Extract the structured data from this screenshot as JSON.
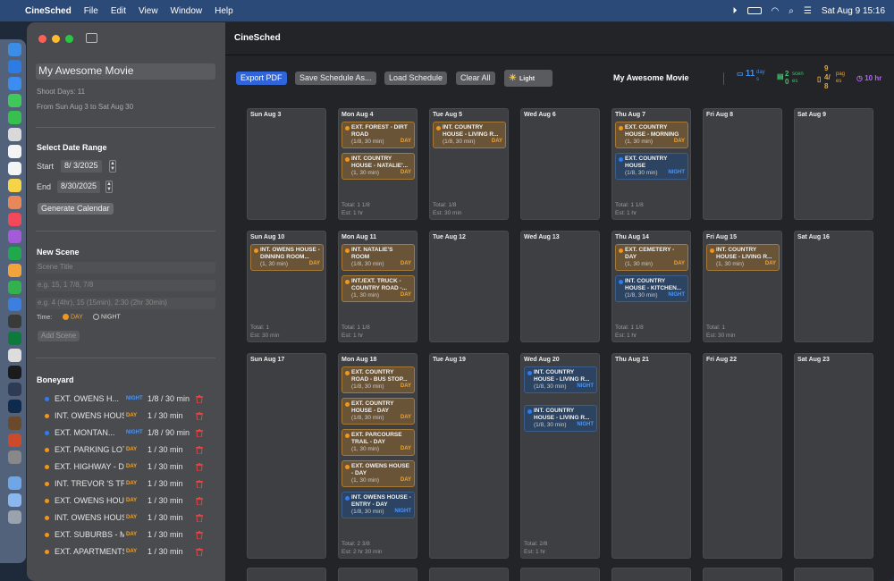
{
  "menubar": {
    "app": "CineSched",
    "items": [
      "File",
      "Edit",
      "View",
      "Window",
      "Help"
    ],
    "datetime": "Sat Aug 9  15:16"
  },
  "sidebar": {
    "movie_title": "My Awesome Movie",
    "shoot_days": "Shoot Days: 11",
    "range_text": "From Sun Aug 3 to Sat Aug 30",
    "date_range_header": "Select Date Range",
    "start_label": "Start",
    "start_value": "8/ 3/2025",
    "end_label": "End",
    "end_value": "8/30/2025",
    "generate_label": "Generate Calendar",
    "new_scene_header": "New Scene",
    "scene_title_placeholder": "Scene Title",
    "pages_placeholder": "e.g. 15, 1 7/8, 7/8",
    "duration_placeholder": "e.g. 4 (4hr), 15 (15min), 2:30 (2hr 30min)",
    "time_label": "Time:",
    "day_label": "DAY",
    "night_label": "NIGHT",
    "add_scene_label": "Add Scene",
    "boneyard_header": "Boneyard",
    "boneyard": [
      {
        "name": "EXT. OWENS H...",
        "tod": "NIGHT",
        "dur": "1/8 / 30 min"
      },
      {
        "name": "INT. OWENS HOUS...",
        "tod": "DAY",
        "dur": "1 / 30 min"
      },
      {
        "name": "EXT. MONTAN...",
        "tod": "NIGHT",
        "dur": "1/8 / 90 min"
      },
      {
        "name": "EXT. PARKING LOT...",
        "tod": "DAY",
        "dur": "1 / 30 min"
      },
      {
        "name": "EXT. HIGHWAY - D...",
        "tod": "DAY",
        "dur": "1 / 30 min"
      },
      {
        "name": "INT. TREVOR 'S TR...",
        "tod": "DAY",
        "dur": "1 / 30 min"
      },
      {
        "name": "EXT. OWENS HOUS...",
        "tod": "DAY",
        "dur": "1 / 30 min"
      },
      {
        "name": "INT. OWENS HOUS...",
        "tod": "DAY",
        "dur": "1 / 30 min"
      },
      {
        "name": "EXT. SUBURBS - M...",
        "tod": "DAY",
        "dur": "1 / 30 min"
      },
      {
        "name": "EXT. APARTMENTS...",
        "tod": "DAY",
        "dur": "1 / 30 min"
      }
    ]
  },
  "main": {
    "title": "CineSched",
    "toolbar": {
      "export": "Export PDF",
      "save": "Save Schedule As...",
      "load": "Load Schedule",
      "clear": "Clear All",
      "light": "Light"
    },
    "movie_title": "My Awesome Movie",
    "stats": {
      "days": "11",
      "days_unit_a": "day",
      "days_unit_b": "s",
      "scenes_a": "2",
      "scenes_b": "0",
      "scenes_unit_a": "scen",
      "scenes_unit_b": "es",
      "pages_a": "9",
      "pages_b": "4/",
      "pages_c": "8",
      "pages_unit_a": "pag",
      "pages_unit_b": "es",
      "hours": "10 hr"
    }
  },
  "calendar": {
    "days": [
      {
        "label": "Sun Aug 3",
        "scenes": [],
        "total": "",
        "est": ""
      },
      {
        "label": "Mon Aug 4",
        "scenes": [
          {
            "title": "EXT. FOREST - DIRT ROAD",
            "meta": "(1/8, 30 min)",
            "tod": "DAY"
          },
          {
            "title": "INT. COUNTRY HOUSE - NATALIE'...",
            "meta": "(1, 30 min)",
            "tod": "DAY"
          }
        ],
        "total": "Total: 1 1/8",
        "est": "Est: 1 hr"
      },
      {
        "label": "Tue Aug 5",
        "scenes": [
          {
            "title": "INT. COUNTRY HOUSE - LIVING R...",
            "meta": "(1/8, 30 min)",
            "tod": "DAY"
          }
        ],
        "total": "Total: 1/8",
        "est": "Est: 30 min"
      },
      {
        "label": "Wed Aug 6",
        "scenes": [],
        "total": "",
        "est": ""
      },
      {
        "label": "Thu Aug 7",
        "scenes": [
          {
            "title": "EXT. COUNTRY HOUSE - MORNING",
            "meta": "(1, 30 min)",
            "tod": "DAY"
          },
          {
            "title": "EXT. COUNTRY HOUSE",
            "meta": "(1/8, 30 min)",
            "tod": "NIGHT"
          }
        ],
        "total": "Total: 1 1/8",
        "est": "Est: 1 hr"
      },
      {
        "label": "Fri Aug 8",
        "scenes": [],
        "total": "",
        "est": ""
      },
      {
        "label": "Sat Aug 9",
        "scenes": [],
        "total": "",
        "est": ""
      },
      {
        "label": "Sun Aug 10",
        "scenes": [
          {
            "title": "INT. OWENS HOUSE - DINNING ROOM...",
            "meta": "(1, 30 min)",
            "tod": "DAY"
          }
        ],
        "total": "Total: 1",
        "est": "Est: 30 min"
      },
      {
        "label": "Mon Aug 11",
        "scenes": [
          {
            "title": "INT. NATALIE'S ROOM",
            "meta": "(1/8, 30 min)",
            "tod": "DAY"
          },
          {
            "title": "INT./EXT. TRUCK - COUNTRY ROAD -...",
            "meta": "(1, 30 min)",
            "tod": "DAY"
          }
        ],
        "total": "Total: 1 1/8",
        "est": "Est: 1 hr"
      },
      {
        "label": "Tue Aug 12",
        "scenes": [],
        "total": "",
        "est": ""
      },
      {
        "label": "Wed Aug 13",
        "scenes": [],
        "total": "",
        "est": ""
      },
      {
        "label": "Thu Aug 14",
        "scenes": [
          {
            "title": "EXT. CEMETERY - DAY",
            "meta": "(1, 30 min)",
            "tod": "DAY"
          },
          {
            "title": "INT. COUNTRY HOUSE - KITCHEN...",
            "meta": "(1/8, 30 min)",
            "tod": "NIGHT"
          }
        ],
        "total": "Total: 1 1/8",
        "est": "Est: 1 hr"
      },
      {
        "label": "Fri Aug 15",
        "scenes": [
          {
            "title": "INT. COUNTRY HOUSE - LIVING R...",
            "meta": "(1, 30 min)",
            "tod": "DAY"
          }
        ],
        "total": "Total: 1",
        "est": "Est: 30 min"
      },
      {
        "label": "Sat Aug 16",
        "scenes": [],
        "total": "",
        "est": ""
      },
      {
        "label": "Sun Aug 17",
        "scenes": [],
        "total": "",
        "est": ""
      },
      {
        "label": "Mon Aug 18",
        "scenes": [
          {
            "title": "EXT. COUNTRY ROAD - BUS STOP...",
            "meta": "(1/8, 30 min)",
            "tod": "DAY"
          },
          {
            "title": "EXT. COUNTRY HOUSE - DAY",
            "meta": "(1/8, 30 min)",
            "tod": "DAY"
          },
          {
            "title": "EXT. PARCOURSE TRAIL - DAY",
            "meta": "(1, 30 min)",
            "tod": "DAY"
          },
          {
            "title": "EXT. OWENS HOUSE - DAY",
            "meta": "(1, 30 min)",
            "tod": "DAY"
          },
          {
            "title": "INT. OWENS HOUSE - ENTRY - DAY",
            "meta": "(1/8, 30 min)",
            "tod": "NIGHT"
          }
        ],
        "total": "Total: 2 3/8",
        "est": "Est: 2 hr 30 min"
      },
      {
        "label": "Tue Aug 19",
        "scenes": [],
        "total": "",
        "est": ""
      },
      {
        "label": "Wed Aug 20",
        "scenes": [
          {
            "title": "INT. COUNTRY HOUSE - LIVING R...",
            "meta": "(1/8, 30 min)",
            "tod": "NIGHT"
          },
          {
            "title": "INT. COUNTRY HOUSE - LIVING R...",
            "meta": "(1/8, 30 min)",
            "tod": "NIGHT"
          }
        ],
        "total": "Total: 2/8",
        "est": "Est: 1 hr"
      },
      {
        "label": "Thu Aug 21",
        "scenes": [],
        "total": "",
        "est": ""
      },
      {
        "label": "Fri Aug 22",
        "scenes": [],
        "total": "",
        "est": ""
      },
      {
        "label": "Sat Aug 23",
        "scenes": [],
        "total": "",
        "est": ""
      }
    ]
  }
}
